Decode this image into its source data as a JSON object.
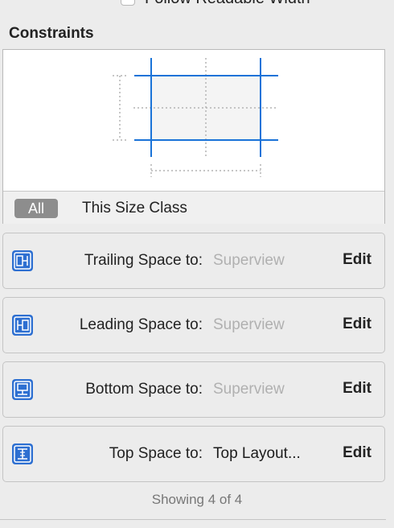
{
  "header": {
    "follow_readable_width_label": "Follow Readable Width",
    "follow_readable_width_checked": false
  },
  "constraints": {
    "title": "Constraints",
    "filter": {
      "all_label": "All",
      "size_class_label": "This Size Class",
      "selected": "All"
    },
    "items": [
      {
        "icon": "trailing-space-icon",
        "label": "Trailing Space to:",
        "value": "Superview",
        "value_muted": true,
        "edit_label": "Edit"
      },
      {
        "icon": "leading-space-icon",
        "label": "Leading Space to:",
        "value": "Superview",
        "value_muted": true,
        "edit_label": "Edit"
      },
      {
        "icon": "bottom-space-icon",
        "label": "Bottom Space to:",
        "value": "Superview",
        "value_muted": true,
        "edit_label": "Edit"
      },
      {
        "icon": "top-space-icon",
        "label": "Top Space to:",
        "value": "Top Layout...",
        "value_muted": false,
        "edit_label": "Edit"
      }
    ],
    "footer": "Showing 4 of 4"
  },
  "colors": {
    "accent": "#1a73d8",
    "icon_blue": "#2d6fd1",
    "selected_segment": "#8d8d8d",
    "muted_text": "#b0b0b0"
  }
}
